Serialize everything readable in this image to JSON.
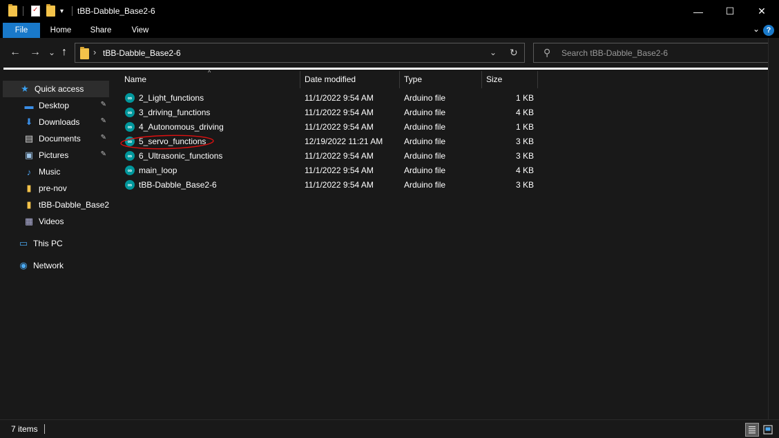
{
  "window": {
    "title": "tBB-Dabble_Base2-6",
    "qat_dropdown_glyph": "▾",
    "minimize_glyph": "—",
    "maximize_glyph": "☐",
    "close_glyph": "✕"
  },
  "ribbon": {
    "tabs": [
      "File",
      "Home",
      "Share",
      "View"
    ],
    "expand_glyph": "⌄",
    "help_glyph": "?",
    "accent": "#1979ca"
  },
  "address": {
    "back_glyph": "←",
    "forward_glyph": "→",
    "recent_glyph": "⌄",
    "up_glyph": "↑",
    "separator": "›",
    "path": "tBB-Dabble_Base2-6",
    "dropdown_glyph": "⌄",
    "refresh_glyph": "↻",
    "search_glyph": "⚲",
    "search_placeholder": "Search tBB-Dabble_Base2-6"
  },
  "nav": {
    "items": [
      {
        "label": "Quick access",
        "icon": "star-icon",
        "glyph": "★",
        "color": "#3aa0f0",
        "pinned": false
      },
      {
        "label": "Desktop",
        "icon": "desktop-icon",
        "glyph": "▬",
        "color": "#3a8ee6",
        "pinned": true
      },
      {
        "label": "Downloads",
        "icon": "download-icon",
        "glyph": "⬇",
        "color": "#3a8ee6",
        "pinned": true
      },
      {
        "label": "Documents",
        "icon": "documents-icon",
        "glyph": "▤",
        "color": "#d8d8d8",
        "pinned": true
      },
      {
        "label": "Pictures",
        "icon": "pictures-icon",
        "glyph": "▣",
        "color": "#9fc5e8",
        "pinned": true
      },
      {
        "label": "Music",
        "icon": "music-icon",
        "glyph": "♪",
        "color": "#4a9de8",
        "pinned": false
      },
      {
        "label": "pre-nov",
        "icon": "folder-icon",
        "glyph": "▮",
        "color": "#f4c34a",
        "pinned": false
      },
      {
        "label": "tBB-Dabble_Base2-6",
        "icon": "folder-icon",
        "glyph": "▮",
        "color": "#f4c34a",
        "pinned": false
      },
      {
        "label": "Videos",
        "icon": "videos-icon",
        "glyph": "▦",
        "color": "#b0b0d8",
        "pinned": false
      },
      {
        "label": "This PC",
        "icon": "computer-icon",
        "glyph": "▭",
        "color": "#4aa8f0",
        "pinned": false
      },
      {
        "label": "Network",
        "icon": "network-icon",
        "glyph": "◉",
        "color": "#4aa8f0",
        "pinned": false
      }
    ],
    "pin_glyph": "📌"
  },
  "columns": {
    "name": "Name",
    "date": "Date modified",
    "type": "Type",
    "size": "Size",
    "sort_glyph": "^"
  },
  "files": [
    {
      "name": "2_Light_functions",
      "date": "11/1/2022 9:54 AM",
      "type": "Arduino file",
      "size": "1 KB"
    },
    {
      "name": "3_driving_functions",
      "date": "11/1/2022 9:54 AM",
      "type": "Arduino file",
      "size": "4 KB"
    },
    {
      "name": "4_Autonomous_driving",
      "date": "11/1/2022 9:54 AM",
      "type": "Arduino file",
      "size": "1 KB"
    },
    {
      "name": "5_servo_functions",
      "date": "12/19/2022 11:21 AM",
      "type": "Arduino file",
      "size": "3 KB"
    },
    {
      "name": "6_Ultrasonic_functions",
      "date": "11/1/2022 9:54 AM",
      "type": "Arduino file",
      "size": "3 KB"
    },
    {
      "name": "main_loop",
      "date": "11/1/2022 9:54 AM",
      "type": "Arduino file",
      "size": "4 KB"
    },
    {
      "name": "tBB-Dabble_Base2-6",
      "date": "11/1/2022 9:54 AM",
      "type": "Arduino file",
      "size": "3 KB"
    }
  ],
  "file_icon_glyph": "∞",
  "annotation_color": "#e01010",
  "status": {
    "items_count": "7 items"
  }
}
